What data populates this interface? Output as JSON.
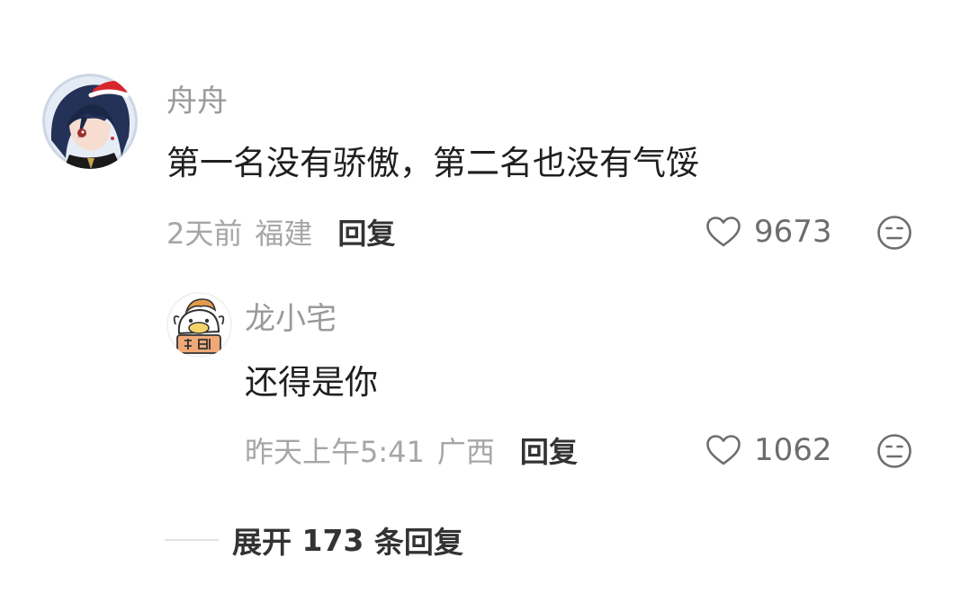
{
  "comment": {
    "username": "舟舟",
    "text": "第一名没有骄傲，第二名也没有气馁",
    "time": "2天前",
    "location": "福建",
    "reply_label": "回复",
    "like_icon": "heart-outline-icon",
    "likes": "9673",
    "dislike_icon": "meh-face-icon"
  },
  "reply": {
    "username": "龙小宅",
    "text": "还得是你",
    "time": "昨天上午5:41",
    "location": "广西",
    "reply_label": "回复",
    "like_icon": "heart-outline-icon",
    "likes": "1062",
    "dislike_icon": "meh-face-icon"
  },
  "expand": {
    "prefix": "展开",
    "count": "173",
    "suffix": "条回复"
  },
  "colors": {
    "background": "#ffffff",
    "username": "#9a9a9a",
    "content": "#1f1f1f",
    "meta": "#a6a6a6",
    "action": "#333333",
    "icon": "#6d6d6d"
  }
}
